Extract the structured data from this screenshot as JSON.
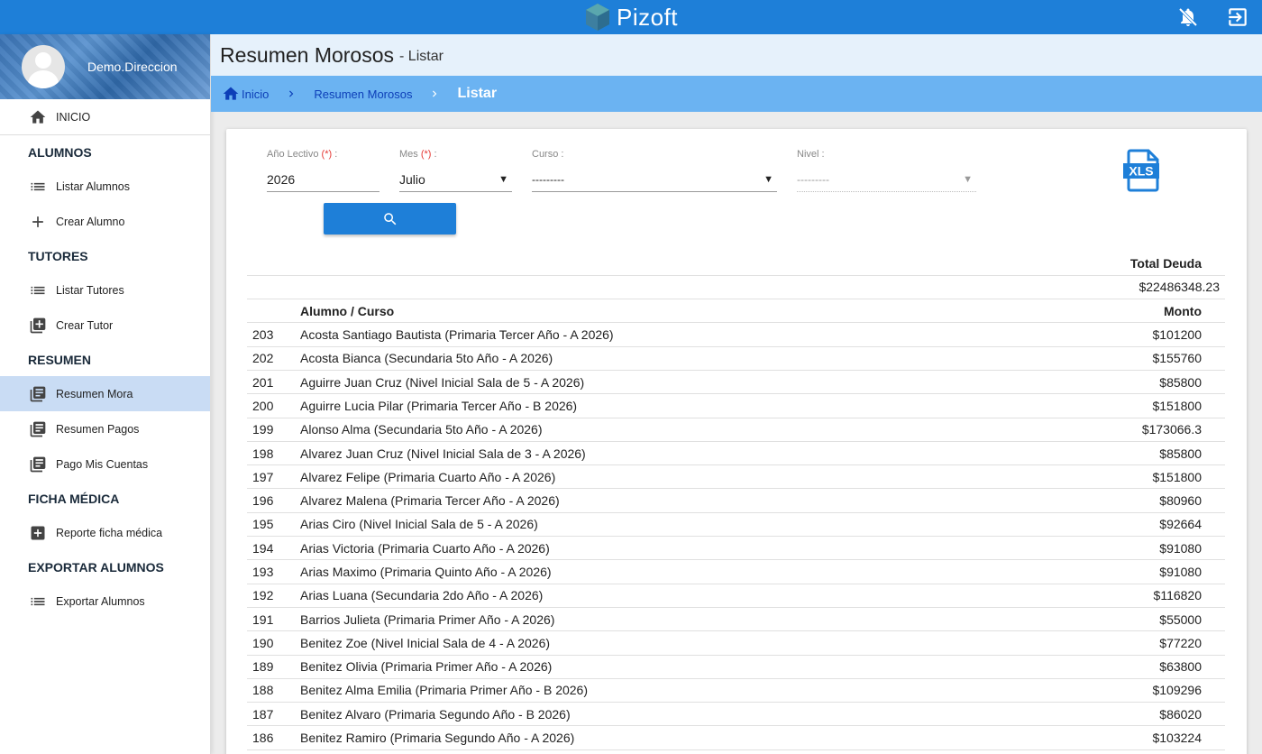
{
  "app": {
    "title": "Pizoft"
  },
  "user": {
    "name": "Demo.Direccion"
  },
  "sidebar": {
    "inicio": "INICIO",
    "sections": [
      {
        "header": "ALUMNOS",
        "items": [
          {
            "label": "Listar Alumnos",
            "icon": "list-icon"
          },
          {
            "label": "Crear Alumno",
            "icon": "plus-icon"
          }
        ]
      },
      {
        "header": "TUTORES",
        "items": [
          {
            "label": "Listar Tutores",
            "icon": "list-icon"
          },
          {
            "label": "Crear Tutor",
            "icon": "add-box-icon"
          }
        ]
      },
      {
        "header": "RESUMEN",
        "items": [
          {
            "label": "Resumen Mora",
            "icon": "library-icon"
          },
          {
            "label": "Resumen Pagos",
            "icon": "library-icon"
          },
          {
            "label": "Pago Mis Cuentas",
            "icon": "library-icon"
          }
        ]
      },
      {
        "header": "FICHA MÉDICA",
        "items": [
          {
            "label": "Reporte ficha médica",
            "icon": "medical-cross-icon"
          }
        ]
      },
      {
        "header": "EXPORTAR ALUMNOS",
        "items": [
          {
            "label": "Exportar Alumnos",
            "icon": "list-icon"
          }
        ]
      }
    ]
  },
  "page": {
    "title": "Resumen Morosos",
    "subtitle": "- Listar"
  },
  "breadcrumb": {
    "home": "Inicio",
    "section": "Resumen Morosos",
    "current": "Listar"
  },
  "filters": {
    "year": {
      "label": "Año Lectivo",
      "required_mark": "(*)",
      "suffix": " :",
      "value": "2026"
    },
    "month": {
      "label": "Mes",
      "required_mark": "(*)",
      "suffix": " :",
      "value": "Julio"
    },
    "course": {
      "label": "Curso :",
      "value": "---------"
    },
    "level": {
      "label": "Nivel :",
      "value": "---------"
    }
  },
  "table": {
    "total_header": "Total Deuda",
    "total_value": "$22486348.23",
    "col_student": "Alumno / Curso",
    "col_amount": "Monto",
    "rows": [
      {
        "id": "203",
        "name": "Acosta Santiago Bautista (Primaria Tercer Año - A 2026)",
        "amount": "$101200"
      },
      {
        "id": "202",
        "name": "Acosta Bianca (Secundaria 5to Año - A 2026)",
        "amount": "$155760"
      },
      {
        "id": "201",
        "name": "Aguirre Juan Cruz (Nivel Inicial Sala de 5 - A 2026)",
        "amount": "$85800"
      },
      {
        "id": "200",
        "name": "Aguirre Lucia Pilar (Primaria Tercer Año - B 2026)",
        "amount": "$151800"
      },
      {
        "id": "199",
        "name": "Alonso Alma (Secundaria 5to Año - A 2026)",
        "amount": "$173066.3"
      },
      {
        "id": "198",
        "name": "Alvarez Juan Cruz (Nivel Inicial Sala de 3 - A 2026)",
        "amount": "$85800"
      },
      {
        "id": "197",
        "name": "Alvarez Felipe (Primaria Cuarto Año - A 2026)",
        "amount": "$151800"
      },
      {
        "id": "196",
        "name": "Alvarez Malena (Primaria Tercer Año - A 2026)",
        "amount": "$80960"
      },
      {
        "id": "195",
        "name": "Arias Ciro (Nivel Inicial Sala de 5 - A 2026)",
        "amount": "$92664"
      },
      {
        "id": "194",
        "name": "Arias Victoria (Primaria Cuarto Año - A 2026)",
        "amount": "$91080"
      },
      {
        "id": "193",
        "name": "Arias Maximo (Primaria Quinto Año - A 2026)",
        "amount": "$91080"
      },
      {
        "id": "192",
        "name": "Arias Luana (Secundaria 2do Año - A 2026)",
        "amount": "$116820"
      },
      {
        "id": "191",
        "name": "Barrios Julieta (Primaria Primer Año - A 2026)",
        "amount": "$55000"
      },
      {
        "id": "190",
        "name": "Benitez Zoe (Nivel Inicial Sala de 4 - A 2026)",
        "amount": "$77220"
      },
      {
        "id": "189",
        "name": "Benitez Olivia (Primaria Primer Año - A 2026)",
        "amount": "$63800"
      },
      {
        "id": "188",
        "name": "Benitez Alma Emilia (Primaria Primer Año - B 2026)",
        "amount": "$109296"
      },
      {
        "id": "187",
        "name": "Benitez Alvaro (Primaria Segundo Año - B 2026)",
        "amount": "$86020"
      },
      {
        "id": "186",
        "name": "Benitez Ramiro (Primaria Segundo Año - A 2026)",
        "amount": "$103224"
      }
    ]
  },
  "colors": {
    "primary": "#1e7fd8",
    "breadcrumb_bg": "#6bb3f2",
    "active_nav": "#c9dcf4",
    "required": "#e53935"
  }
}
